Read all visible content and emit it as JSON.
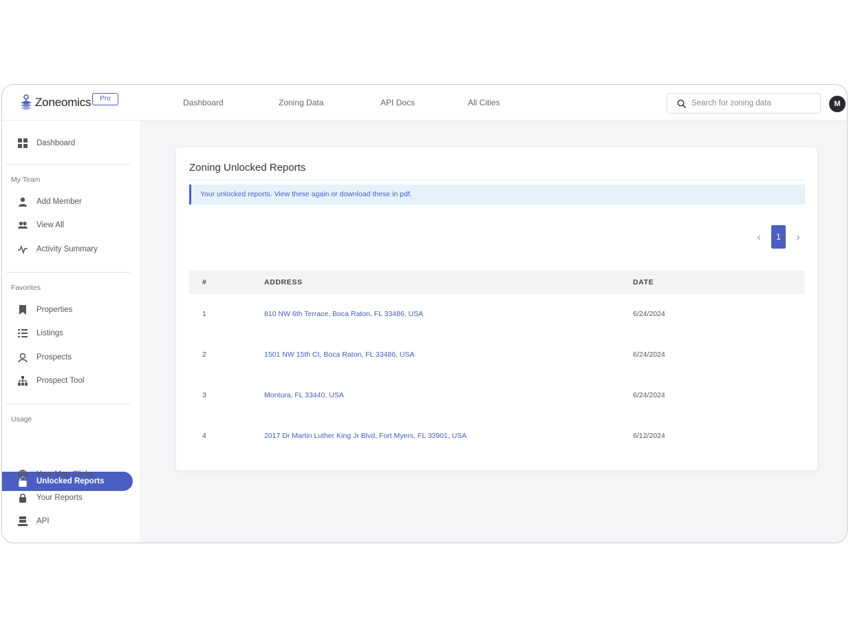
{
  "app": {
    "logo_text": "Zoneomics",
    "badge": "Pro"
  },
  "topnav": {
    "items": [
      "Dashboard",
      "Zoning Data",
      "API Docs",
      "All Cities"
    ],
    "search_placeholder": "Search for zoning data",
    "avatar_initial": "M"
  },
  "sidebar": {
    "dashboard": "Dashboard",
    "my_team": {
      "heading": "My Team",
      "items": [
        "Add Member",
        "View All",
        "Activity Summary"
      ]
    },
    "favorites": {
      "heading": "Favorites",
      "items": [
        "Properties",
        "Listings",
        "Prospects",
        "Prospect Tool"
      ]
    },
    "usage": {
      "heading": "Usage",
      "active": "Unlocked Reports",
      "items": [
        "Your Map Clicks",
        "Your Reports",
        "API"
      ]
    }
  },
  "main": {
    "title": "Zoning Unlocked Reports",
    "info": "Your unlocked reports. View these again or download these in pdf.",
    "pagination": {
      "current": "1",
      "prev": "‹",
      "next": "›"
    },
    "table": {
      "headers": [
        "#",
        "ADDRESS",
        "DATE"
      ],
      "rows": [
        {
          "num": "1",
          "address": "810 NW 6th Terrace, Boca Raton, FL 33486, USA",
          "date": "6/24/2024"
        },
        {
          "num": "2",
          "address": "1501 NW 15th Ct, Boca Raton, FL 33486, USA",
          "date": "6/24/2024"
        },
        {
          "num": "3",
          "address": "Montura, FL 33440, USA",
          "date": "6/24/2024"
        },
        {
          "num": "4",
          "address": "2017 Dr Martin Luther King Jr Blvd, Fort Myers, FL 33901, USA",
          "date": "6/12/2024"
        }
      ]
    }
  },
  "colors": {
    "accent": "#4a5fc1",
    "link": "#3f5fb6",
    "info_bg": "#e6f1fa",
    "main_bg": "#f5f5f7"
  }
}
